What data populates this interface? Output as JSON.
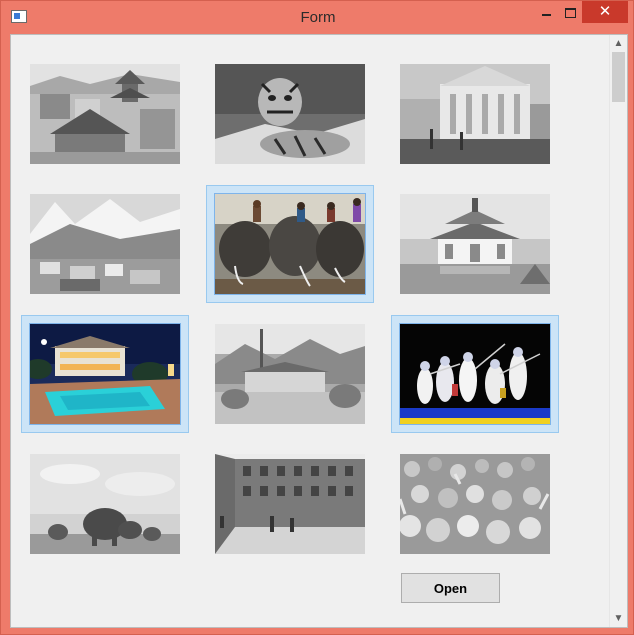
{
  "window": {
    "title": "Form",
    "close_glyph": "✕"
  },
  "scrollbar": {
    "up_glyph": "▲",
    "down_glyph": "▼"
  },
  "gallery": {
    "images": [
      {
        "subject": "city-temple",
        "selected": false
      },
      {
        "subject": "tiger",
        "selected": false
      },
      {
        "subject": "palace",
        "selected": false
      },
      {
        "subject": "mountain-village",
        "selected": false
      },
      {
        "subject": "elephant-riders",
        "selected": true
      },
      {
        "subject": "pagoda-temple",
        "selected": false
      },
      {
        "subject": "pool-resort",
        "selected": true
      },
      {
        "subject": "mountain-monastery",
        "selected": false
      },
      {
        "subject": "fencing",
        "selected": true
      },
      {
        "subject": "elephants",
        "selected": false
      },
      {
        "subject": "street",
        "selected": false
      },
      {
        "subject": "crowd",
        "selected": false
      }
    ]
  },
  "actions": {
    "open_label": "Open"
  }
}
